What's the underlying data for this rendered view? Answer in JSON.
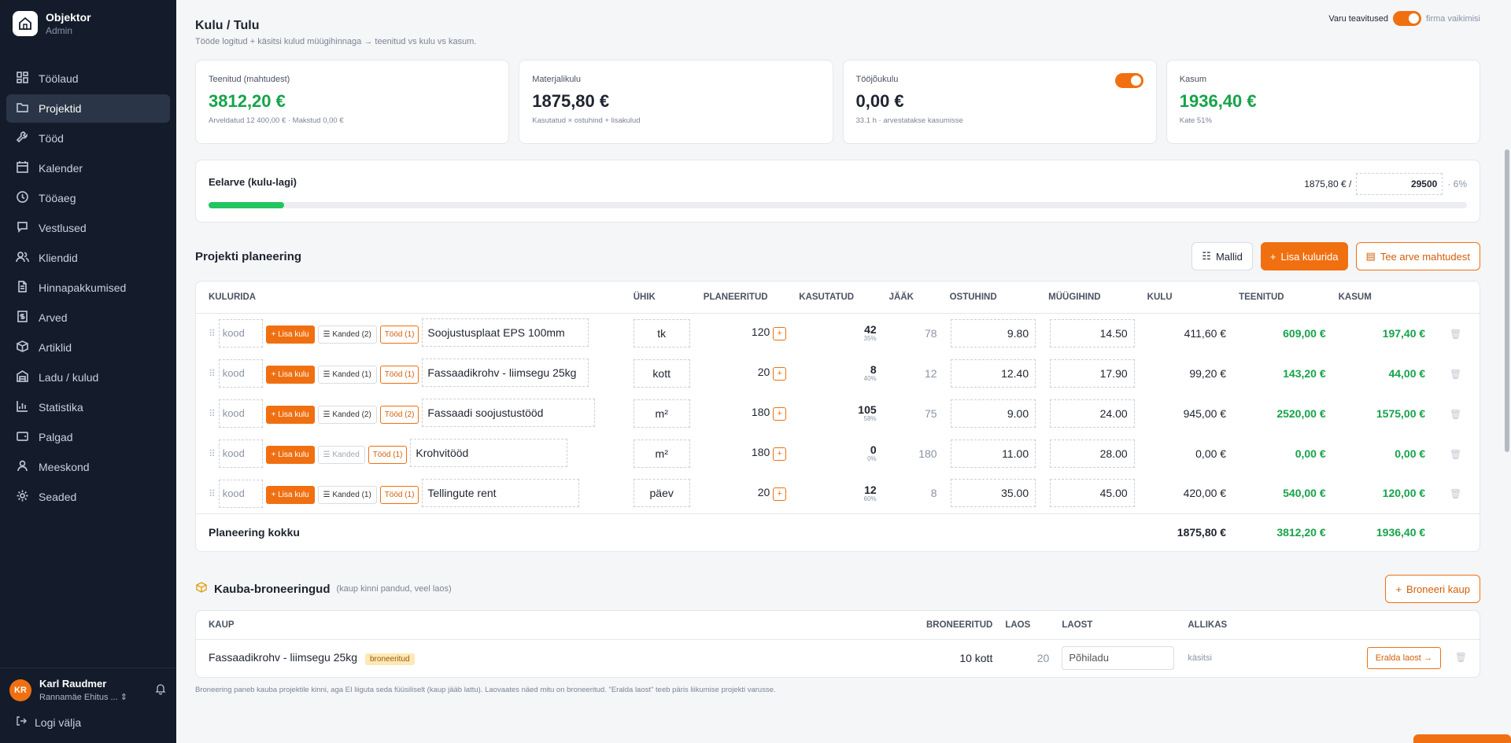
{
  "brand": {
    "name": "Objektor",
    "role": "Admin"
  },
  "nav": [
    {
      "label": "Töölaud",
      "icon": "dashboard-icon"
    },
    {
      "label": "Projektid",
      "icon": "folder-icon"
    },
    {
      "label": "Tööd",
      "icon": "wrench-icon"
    },
    {
      "label": "Kalender",
      "icon": "calendar-icon"
    },
    {
      "label": "Tööaeg",
      "icon": "clock-icon"
    },
    {
      "label": "Vestlused",
      "icon": "chat-icon"
    },
    {
      "label": "Kliendid",
      "icon": "users-icon"
    },
    {
      "label": "Hinnapakkumised",
      "icon": "document-icon"
    },
    {
      "label": "Arved",
      "icon": "invoice-icon"
    },
    {
      "label": "Artiklid",
      "icon": "box-icon"
    },
    {
      "label": "Ladu / kulud",
      "icon": "warehouse-icon"
    },
    {
      "label": "Statistika",
      "icon": "chart-icon"
    },
    {
      "label": "Palgad",
      "icon": "wallet-icon"
    },
    {
      "label": "Meeskond",
      "icon": "team-icon"
    },
    {
      "label": "Seaded",
      "icon": "gear-icon"
    }
  ],
  "user": {
    "initials": "KR",
    "name": "Karl Raudmer",
    "company": "Rannamäe Ehitus ..."
  },
  "logout_label": "Logi välja",
  "header": {
    "title": "Kulu / Tulu",
    "subtitle": "Tööde logitud + käsitsi kulud müügihinnaga → teenitud vs kulu vs kasum.",
    "toggle_label": "Varu teavitused",
    "toggle_note": "firma vaikimisi"
  },
  "stats": [
    {
      "label": "Teenitud (mahtudest)",
      "value": "3812,20 €",
      "note": "Arveldatud 12 400,00 € · Makstud 0,00 €"
    },
    {
      "label": "Materjalikulu",
      "value": "1875,80 €",
      "note": "Kasutatud × ostuhind + lisakulud"
    },
    {
      "label": "Tööjõukulu",
      "value": "0,00 €",
      "note": "33.1 h · arvestatakse kasumisse"
    },
    {
      "label": "Kasum",
      "value": "1936,40 €",
      "note": "Kate 51%"
    }
  ],
  "budget": {
    "label": "Eelarve (kulu-lagi)",
    "spent": "1875,80 € /",
    "limit": "29500",
    "pct_label": "· 6%",
    "progress": 0.06
  },
  "planning": {
    "title": "Projekti planeering",
    "btn_templates": "Mallid",
    "btn_add": "Lisa kulurida",
    "btn_invoice": "Tee arve mahtudest",
    "columns": [
      "KULURIDA",
      "ÜHIK",
      "PLANEERITUD",
      "KASUTATUD",
      "JÄÄK",
      "OSTUHIND",
      "MÜÜGIHIND",
      "KULU",
      "TEENITUD",
      "KASUM"
    ],
    "code_placeholder": "kood",
    "add_cost_label": "Lisa kulu",
    "rows": [
      {
        "entries": "Kanded (2)",
        "works": "Tööd (1)",
        "name": "Soojustusplaat EPS 100mm",
        "unit": "tk",
        "planned": "120",
        "used": "42",
        "used_pct": "35%",
        "remaining": "78",
        "buy": "9.80",
        "sell": "14.50",
        "cost": "411,60 €",
        "earned": "609,00 €",
        "profit": "197,40 €"
      },
      {
        "entries": "Kanded (1)",
        "works": "Tööd (1)",
        "name": "Fassaadikrohv - liimsegu 25kg",
        "unit": "kott",
        "planned": "20",
        "used": "8",
        "used_pct": "40%",
        "remaining": "12",
        "buy": "12.40",
        "sell": "17.90",
        "cost": "99,20 €",
        "earned": "143,20 €",
        "profit": "44,00 €"
      },
      {
        "entries": "Kanded (2)",
        "works": "Tööd (2)",
        "name": "Fassaadi soojustustööd",
        "unit": "m²",
        "planned": "180",
        "used": "105",
        "used_pct": "58%",
        "remaining": "75",
        "buy": "9.00",
        "sell": "24.00",
        "cost": "945,00 €",
        "earned": "2520,00 €",
        "profit": "1575,00 €"
      },
      {
        "entries": "Kanded",
        "works": "Tööd (1)",
        "name": "Krohvitööd",
        "unit": "m²",
        "planned": "180",
        "used": "0",
        "used_pct": "0%",
        "remaining": "180",
        "buy": "11.00",
        "sell": "28.00",
        "cost": "0,00 €",
        "earned": "0,00 €",
        "profit": "0,00 €"
      },
      {
        "entries": "Kanded (1)",
        "works": "Tööd (1)",
        "name": "Tellingute rent",
        "unit": "päev",
        "planned": "20",
        "used": "12",
        "used_pct": "60%",
        "remaining": "8",
        "buy": "35.00",
        "sell": "45.00",
        "cost": "420,00 €",
        "earned": "540,00 €",
        "profit": "120,00 €"
      }
    ],
    "total": {
      "label": "Planeering kokku",
      "cost": "1875,80 €",
      "earned": "3812,20 €",
      "profit": "1936,40 €"
    }
  },
  "reservations": {
    "title": "Kauba-broneeringud",
    "subtitle": "(kaup kinni pandud, veel laos)",
    "btn_reserve": "Broneeri kaup",
    "columns": [
      "KAUP",
      "BRONEERITUD",
      "LAOS",
      "LAOST",
      "ALLIKAS"
    ],
    "row": {
      "item": "Fassaadikrohv - liimsegu 25kg",
      "badge": "broneeritud",
      "reserved": "10 kott",
      "stock": "20",
      "warehouse": "Põhiladu",
      "source": "käsitsi",
      "release": "Eralda laost →"
    },
    "note": "Broneering paneb kauba projektile kinni, aga EI liiguta seda füüsiliselt (kaup jääb lattu). Laovaates näed mitu on broneeritud. \"Eralda laost\" teeb päris liikumise projekti varusse."
  }
}
